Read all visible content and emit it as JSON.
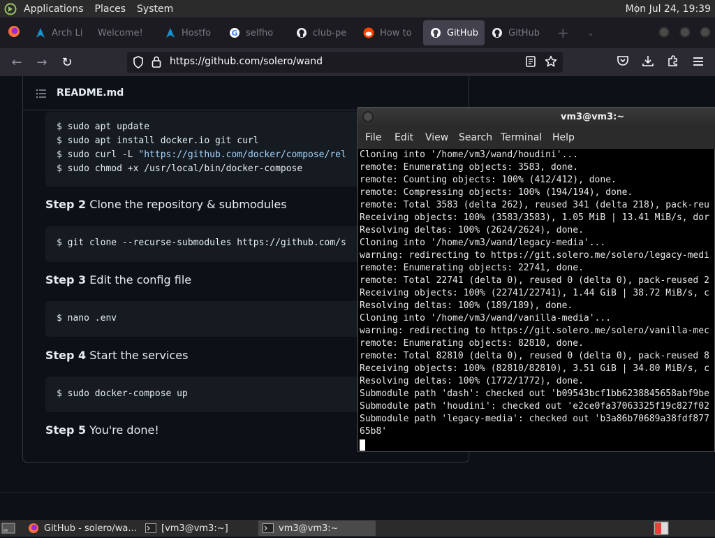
{
  "top_panel": {
    "menus": [
      "Applications",
      "Places",
      "System"
    ],
    "clock": "Mon Jul 24, 19:39"
  },
  "tabs": [
    {
      "label": "Arch Li",
      "icon": "arch-icon"
    },
    {
      "label": "Welcome!",
      "icon": "none"
    },
    {
      "label": "Hostfo",
      "icon": "arch-icon"
    },
    {
      "label": "selfho",
      "icon": "google-icon"
    },
    {
      "label": "club-pe",
      "icon": "github-icon"
    },
    {
      "label": "How to",
      "icon": "reddit-icon"
    },
    {
      "label": "GitHub",
      "icon": "github-icon",
      "active": true
    },
    {
      "label": "GitHub",
      "icon": "github-icon"
    }
  ],
  "navbar": {
    "url": "https://github.com/solero/wand"
  },
  "readme": {
    "title": "README.md",
    "code1": [
      "$ sudo apt update",
      "$ sudo apt install docker.io git curl",
      "$ sudo curl -L ",
      "\"https://github.com/docker/compose/rel",
      "$ sudo chmod +x /usr/local/bin/docker-compose"
    ],
    "step2_label": "Step 2",
    "step2_text": " Clone the repository & submodules",
    "code2": "$ git clone --recurse-submodules https://github.com/s",
    "step3_label": "Step 3",
    "step3_text": " Edit the config file",
    "code3": "$ nano .env",
    "step4_label": "Step 4",
    "step4_text": " Start the services",
    "code4": "$ sudo docker-compose up",
    "step5_label": "Step 5",
    "step5_text": " You're done!"
  },
  "terminal": {
    "title": "vm3@vm3:~",
    "menu": [
      "File",
      "Edit",
      "View",
      "Search",
      "Terminal",
      "Help"
    ],
    "lines": [
      "Cloning into '/home/vm3/wand/houdini'...",
      "remote: Enumerating objects: 3583, done.",
      "remote: Counting objects: 100% (412/412), done.",
      "remote: Compressing objects: 100% (194/194), done.",
      "remote: Total 3583 (delta 262), reused 341 (delta 218), pack-reu",
      "Receiving objects: 100% (3583/3583), 1.05 MiB | 13.41 MiB/s, dor",
      "Resolving deltas: 100% (2624/2624), done.",
      "Cloning into '/home/vm3/wand/legacy-media'...",
      "warning: redirecting to https://git.solero.me/solero/legacy-medi",
      "remote: Enumerating objects: 22741, done.",
      "remote: Total 22741 (delta 0), reused 0 (delta 0), pack-reused 2",
      "Receiving objects: 100% (22741/22741), 1.44 GiB | 38.72 MiB/s, c",
      "Resolving deltas: 100% (189/189), done.",
      "Cloning into '/home/vm3/wand/vanilla-media'...",
      "warning: redirecting to https://git.solero.me/solero/vanilla-mec",
      "remote: Enumerating objects: 82810, done.",
      "remote: Total 82810 (delta 0), reused 0 (delta 0), pack-reused 8",
      "Receiving objects: 100% (82810/82810), 3.51 GiB | 34.80 MiB/s, c",
      "Resolving deltas: 100% (1772/1772), done.",
      "Submodule path 'dash': checked out 'b09543bcf1bb6238845658abf9be",
      "Submodule path 'houdini': checked out 'e2ce0fa37063325f19c827f02",
      "Submodule path 'legacy-media': checked out 'b3a86b70689a38fdf877",
      "65b8'"
    ]
  },
  "taskbar": {
    "tasks": [
      {
        "label": "GitHub - solero/wa...",
        "icon": "firefox-icon"
      },
      {
        "label": "[vm3@vm3:~]",
        "icon": "terminal-icon"
      },
      {
        "label": "vm3@vm3:~",
        "icon": "terminal-icon",
        "active": true
      }
    ]
  },
  "colors": {
    "accent_red": "#e0433a",
    "github_bg": "#0d1117",
    "code_bg": "#161b22"
  }
}
